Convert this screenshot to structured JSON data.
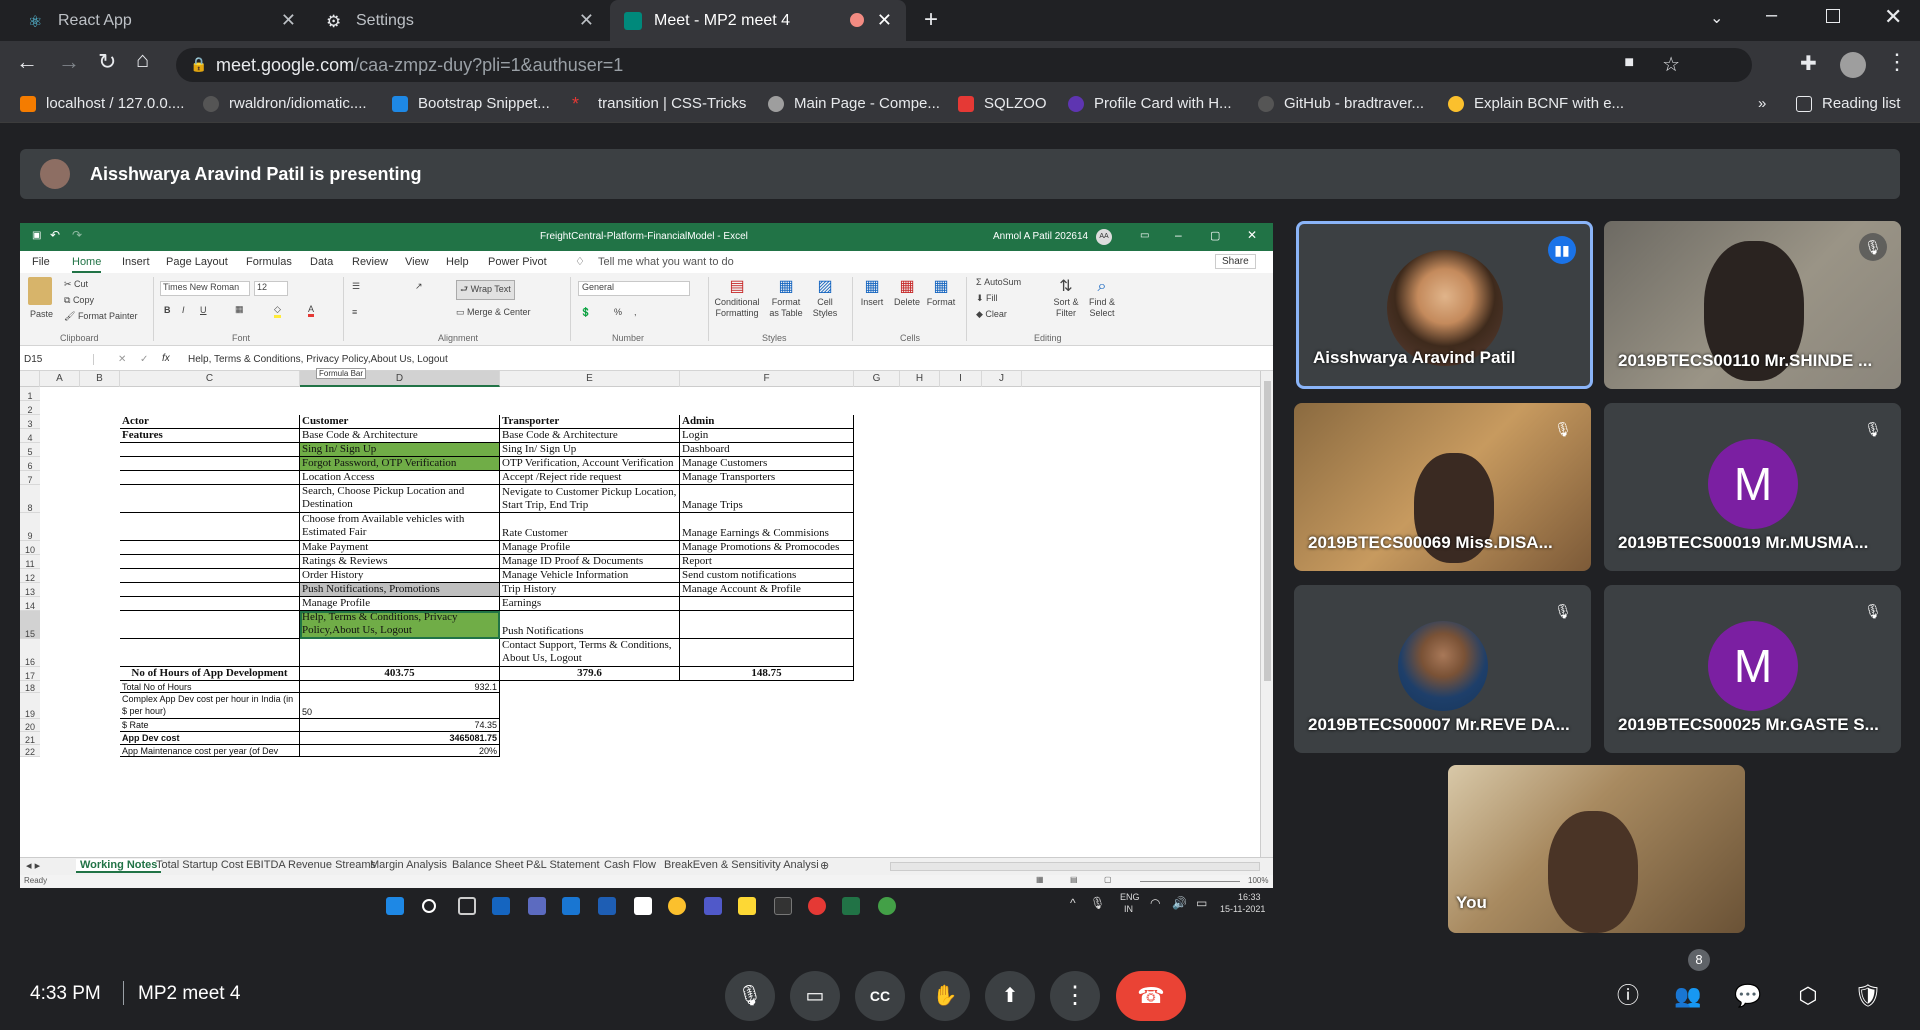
{
  "browser": {
    "tabs": [
      {
        "title": "React App"
      },
      {
        "title": "Settings"
      },
      {
        "title": "Meet - MP2 meet 4"
      }
    ],
    "url_host": "meet.google.com",
    "url_path": "/caa-zmpz-duy?pli=1&authuser=1",
    "bookmarks": [
      "localhost / 127.0.0....",
      "rwaldron/idiomatic....",
      "Bootstrap Snippet...",
      "transition | CSS-Tricks",
      "Main Page - Compe...",
      "SQLZOO",
      "Profile Card with H...",
      "GitHub - bradtraver...",
      "Explain BCNF with e..."
    ],
    "more_bookmarks": "»",
    "reading_list": "Reading list"
  },
  "meet": {
    "presenting_text": "Aisshwarya Aravind Patil is presenting",
    "time": "4:33 PM",
    "meeting_name": "MP2 meet 4",
    "participant_count": "8",
    "participants": [
      {
        "name": "Aisshwarya Aravind Patil"
      },
      {
        "name": "2019BTECS00110 Mr.SHINDE ..."
      },
      {
        "name": "2019BTECS00069 Miss.DISA..."
      },
      {
        "name": "2019BTECS00019 Mr.MUSMA...",
        "initial": "M"
      },
      {
        "name": "2019BTECS00007 Mr.REVE DA..."
      },
      {
        "name": "2019BTECS00025 Mr.GASTE S...",
        "initial": "M"
      },
      {
        "name": "You"
      }
    ]
  },
  "excel": {
    "title": "FreightCentral-Platform-FinancialModel - Excel",
    "user": "Anmol A Patil 202614",
    "user_initials": "AA",
    "menu": [
      "File",
      "Home",
      "Insert",
      "Page Layout",
      "Formulas",
      "Data",
      "Review",
      "View",
      "Help",
      "Power Pivot"
    ],
    "tell_me": "Tell me what you want to do",
    "share": "Share",
    "ribbon": {
      "paste": "Paste",
      "cut": "Cut",
      "copy": "Copy",
      "format_painter": "Format Painter",
      "clipboard": "Clipboard",
      "font_name": "Times New Roman",
      "font_size": "12",
      "font": "Font",
      "wrap_text": "Wrap Text",
      "merge_center": "Merge & Center",
      "alignment": "Alignment",
      "number_format": "General",
      "number": "Number",
      "conditional_formatting": "Conditional Formatting",
      "format_as_table": "Format as Table",
      "cell_styles": "Cell Styles",
      "styles": "Styles",
      "insert": "Insert",
      "delete": "Delete",
      "format": "Format",
      "cells": "Cells",
      "autosum": "AutoSum",
      "fill": "Fill",
      "clear": "Clear",
      "sort_filter": "Sort & Filter",
      "find_select": "Find & Select",
      "editing": "Editing"
    },
    "name_box": "D15",
    "formula": "Help, Terms & Conditions, Privacy Policy,About Us, Logout",
    "formula_tooltip": "Formula Bar",
    "columns": [
      "A",
      "B",
      "C",
      "D",
      "E",
      "F",
      "G",
      "H",
      "I",
      "J"
    ],
    "rows": {
      "r3": [
        "Actor",
        "Customer",
        "Transporter",
        "Admin"
      ],
      "r4": [
        "Features",
        "Base Code & Architecture",
        "Base Code & Architecture",
        "Login"
      ],
      "r5": [
        "",
        "Sing In/ Sign Up",
        "Sing In/ Sign Up",
        "Dashboard"
      ],
      "r6": [
        "",
        "Forgot Password, OTP Verification",
        "OTP Verification, Account Verification",
        "Manage Customers"
      ],
      "r7": [
        "",
        "Location Access",
        "Accept /Reject ride request",
        "Manage Transporters"
      ],
      "r8": [
        "",
        "Search, Choose Pickup Location and Destination",
        "Nevigate to Customer Pickup Location, Start Trip, End Trip",
        "Manage Trips"
      ],
      "r9": [
        "",
        "Choose from Available vehicles with Estimated Fair",
        "Rate Customer",
        "Manage Earnings & Commisions"
      ],
      "r10": [
        "",
        "Make Payment",
        "Manage Profile",
        "Manage Promotions & Promocodes"
      ],
      "r11": [
        "",
        "Ratings & Reviews",
        "Manage ID Proof & Documents",
        "Report"
      ],
      "r12": [
        "",
        "Order History",
        "Manage Vehicle Information",
        "Send custom notifications"
      ],
      "r13": [
        "",
        "Push Notifications, Promotions",
        "Trip History",
        "Manage Account & Profile"
      ],
      "r14": [
        "",
        "Manage Profile",
        "Earnings",
        ""
      ],
      "r15": [
        "",
        "Help, Terms & Conditions, Privacy Policy,About Us, Logout",
        "Push Notifications",
        ""
      ],
      "r16": [
        "",
        "",
        "Contact Support, Terms & Conditions, About Us, Logout",
        ""
      ],
      "r17": [
        "No of Hours of App Development",
        "403.75",
        "379.6",
        "148.75"
      ],
      "r18": [
        "Total No of Hours",
        "932.1"
      ],
      "r19": [
        "Complex App Dev cost per hour in India (in $ per hour)",
        "50"
      ],
      "r20": [
        "$ Rate",
        "74.35"
      ],
      "r21": [
        "App Dev cost",
        "3465081.75"
      ],
      "r22": [
        "App Maintenance cost per year (of Dev cost)",
        "20%"
      ]
    },
    "sheets": [
      "Working Notes",
      "Total Startup Cost",
      "EBITDA",
      "Revenue Streams",
      "Margin Analysis",
      "Balance Sheet",
      "P&L Statement",
      "Cash Flow",
      "BreakEven & Sensitivity Analysi"
    ],
    "status": "Ready",
    "zoom": "100%"
  },
  "windows_taskbar": {
    "lang": "ENG",
    "region": "IN",
    "clock_time": "16:33",
    "clock_date": "15-11-2021"
  },
  "colors": {
    "meet_bg": "#202124",
    "excel_green": "#217346",
    "cell_green": "#70ad47",
    "hangup_red": "#ea4335",
    "avatar_purple": "#7b1fa2",
    "active_speaker_blue": "#8ab4f8"
  }
}
